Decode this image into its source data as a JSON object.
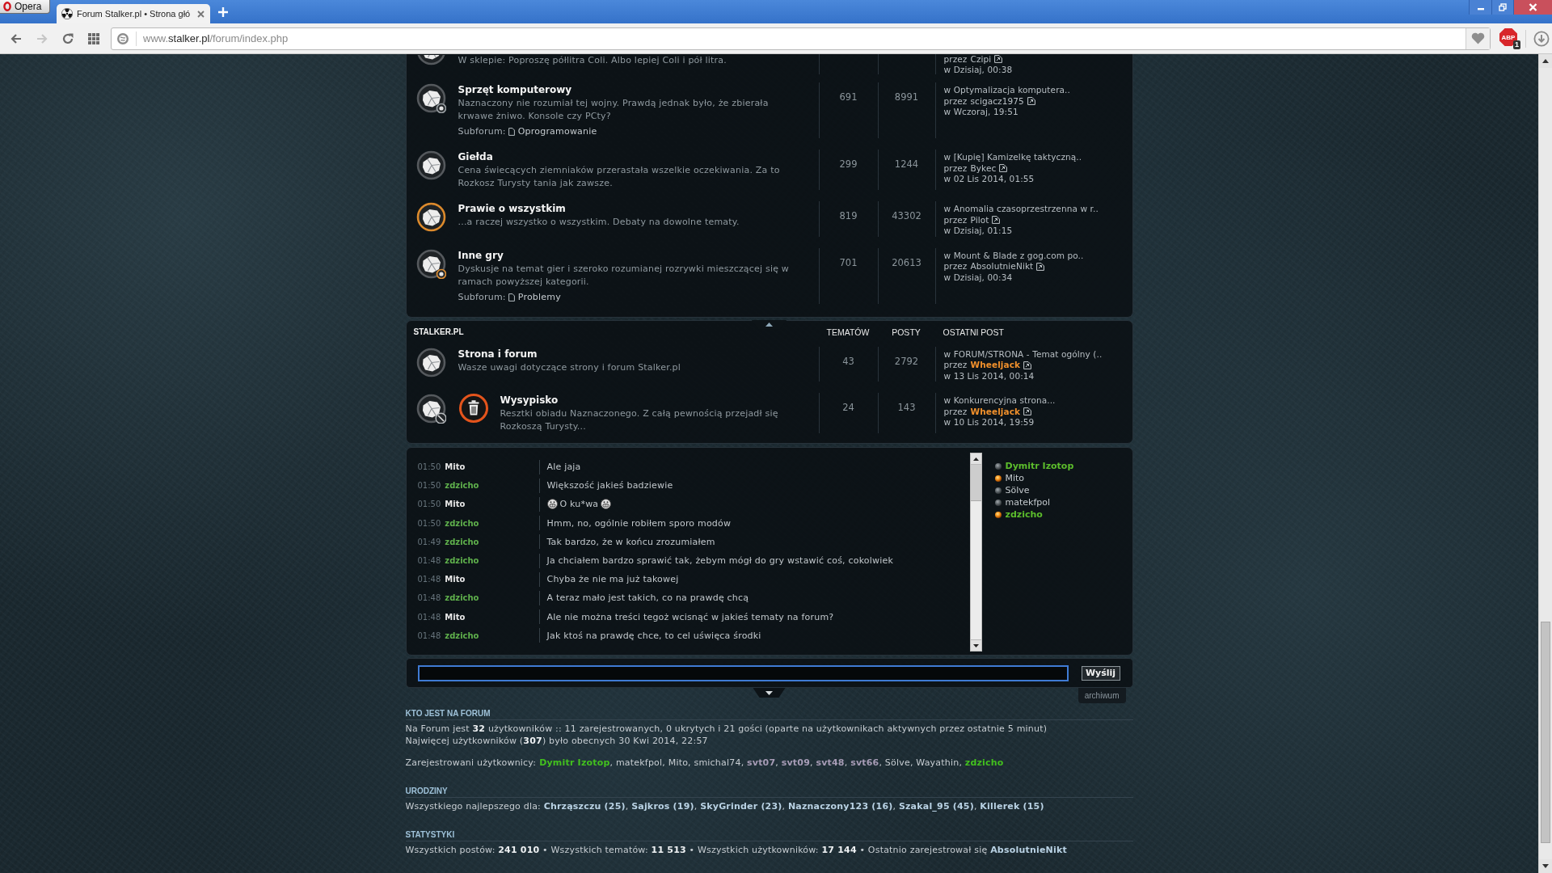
{
  "browser": {
    "menu_button": "Opera",
    "tabs": [
      {
        "title": "Forum Stalker.pl • Strona głó",
        "selected": true
      }
    ],
    "nav_buttons": [
      {
        "kind": "back",
        "disabled": false
      },
      {
        "kind": "forward",
        "disabled": true
      },
      {
        "kind": "reload",
        "disabled": false
      },
      {
        "kind": "speed-dial",
        "disabled": false
      }
    ],
    "address": {
      "prefix": "www.",
      "domain": "stalker.pl",
      "path": "/forum/index.php"
    },
    "extension": {
      "label": "ABP",
      "badge": "1"
    }
  },
  "categories": [
    {
      "forums": [
        {
          "kind": "clipped",
          "unread": false,
          "locked": false,
          "description": "W sklepie: Poproszę półlitra Coli. Albo lepiej Coli i pół litra.",
          "last_post": {
            "by": "przez",
            "author": "Czipi",
            "kind": "plain",
            "color": "#b9c0c5",
            "date": "w Dzisiaj, 00:38"
          }
        },
        {
          "kind": "full",
          "unread": false,
          "locked": false,
          "title": "Sprzęt komputerowy",
          "description": "Naznaczony nie rozumiał tej wojny. Prawdą jednak było, że zbierała krwawe żniwo. Konsole czy PCty?",
          "subforum": {
            "label": "Subforum:",
            "link": "Oprogramowanie",
            "unread": false
          },
          "topics": "691",
          "posts": "8991",
          "last_post": {
            "topic": "w Optymalizacja komputera..",
            "by": "przez",
            "author": "scigacz1975",
            "kind": "plain",
            "color": "#b9c0c5",
            "date": "w Wczoraj, 19:51"
          }
        },
        {
          "kind": "full",
          "unread": false,
          "locked": false,
          "title": "Giełda",
          "description": "Cena świecących ziemniaków przerastała wszelkie oczekiwania. Za to Rozkosz Turysty tania jak zawsze.",
          "topics": "299",
          "posts": "1244",
          "last_post": {
            "topic": "w [Kupię] Kamizelkę taktyczną..",
            "by": "przez",
            "author": "Bykec",
            "kind": "plain",
            "color": "#b9c0c5",
            "date": "w 02 Lis 2014, 01:55"
          }
        },
        {
          "kind": "full",
          "unread": true,
          "locked": false,
          "title": "Prawie o wszystkim",
          "description": "...a raczej wszystko o wszystkim. Debaty na dowolne tematy.",
          "topics": "819",
          "posts": "43302",
          "last_post": {
            "topic": "w Anomalia czasoprzestrzenna w r..",
            "by": "przez",
            "author": "Pilot",
            "kind": "plain",
            "color": "#b9c0c5",
            "date": "w Dzisiaj, 01:15"
          }
        },
        {
          "kind": "full",
          "unread": false,
          "locked": false,
          "title": "Inne gry",
          "description": "Dyskusje na temat gier i szeroko rozumianej rozrywki mieszczącej się w ramach powyższej kategorii.",
          "subforum": {
            "label": "Subforum:",
            "link": "Problemy",
            "unread": true
          },
          "topics": "701",
          "posts": "20613",
          "last_post": {
            "topic": "w Mount & Blade z gog.com po..",
            "by": "przez",
            "author": "AbsolutnieNikt",
            "kind": "plain",
            "color": "#b9c0c5",
            "date": "w Dzisiaj, 00:34"
          }
        }
      ]
    },
    {
      "header": {
        "title": "STALKER.PL",
        "columns": [
          "TEMATÓW",
          "POSTY",
          "OSTATNI POST"
        ]
      },
      "forums": [
        {
          "kind": "full",
          "unread": false,
          "locked": false,
          "title": "Strona i forum",
          "description": "Wasze uwagi dotyczące strony i forum Stalker.pl",
          "topics": "43",
          "posts": "2792",
          "last_post": {
            "topic": "w FORUM/STRONA - Temat ogólny (..",
            "by": "przez",
            "author": "Wheeljack",
            "kind": "colored",
            "color": "#f0902c",
            "date": "w 13 Lis 2014, 00:14"
          }
        },
        {
          "kind": "trash",
          "unread": false,
          "locked": true,
          "title": "Wysypisko",
          "description": "Resztki obiadu Naznaczonego. Z całą pewnością przejadł się Rozkoszą Turysty...",
          "topics": "24",
          "posts": "143",
          "last_post": {
            "topic": "w Konkurencyjna strona...",
            "by": "przez",
            "author": "Wheeljack",
            "kind": "colored",
            "color": "#f0902c",
            "date": "w 10 Lis 2014, 19:59"
          }
        }
      ]
    }
  ],
  "chat": {
    "messages": [
      {
        "time": "01:50",
        "user": "Mito",
        "color": "#e8e8e8",
        "kind": "text",
        "text": "Ale jaja"
      },
      {
        "time": "01:50",
        "user": "zdzicho",
        "color": "#5fb04c",
        "kind": "text",
        "text": "Większość jakieś badziewie"
      },
      {
        "time": "01:50",
        "user": "Mito",
        "color": "#e8e8e8",
        "kind": "smileys",
        "text": "O ku*wa"
      },
      {
        "time": "01:50",
        "user": "zdzicho",
        "color": "#5fb04c",
        "kind": "text",
        "text": "Hmm, no, ogólnie robiłem sporo modów"
      },
      {
        "time": "01:49",
        "user": "zdzicho",
        "color": "#5fb04c",
        "kind": "text",
        "text": "Tak bardzo, że w końcu zrozumiałem"
      },
      {
        "time": "01:48",
        "user": "zdzicho",
        "color": "#5fb04c",
        "kind": "text",
        "text": "Ja chciałem bardzo sprawić tak, żebym mógł do gry wstawić coś, cokolwiek"
      },
      {
        "time": "01:48",
        "user": "Mito",
        "color": "#e8e8e8",
        "kind": "text",
        "text": "Chyba że nie ma już takowej"
      },
      {
        "time": "01:48",
        "user": "zdzicho",
        "color": "#5fb04c",
        "kind": "text",
        "text": "A teraz mało jest takich, co na prawdę chcą"
      },
      {
        "time": "01:48",
        "user": "Mito",
        "color": "#e8e8e8",
        "kind": "text",
        "text": "Ale nie można treści tegoż wcisnąć w jakieś tematy na forum?"
      },
      {
        "time": "01:48",
        "user": "zdzicho",
        "color": "#5fb04c",
        "kind": "text",
        "text": "Jak ktoś na prawdę chce, to cel uświęca środki"
      }
    ],
    "online": [
      {
        "name": "Dymitr Izotop",
        "kind": "colored",
        "color": "#5cbd2c",
        "active": false
      },
      {
        "name": "Mito",
        "kind": "plain",
        "color": "#c3c9cd",
        "active": true
      },
      {
        "name": "Sölve",
        "kind": "plain",
        "color": "#c3c9cd",
        "active": false
      },
      {
        "name": "matekfpol",
        "kind": "plain",
        "color": "#c3c9cd",
        "active": false
      },
      {
        "name": "zdzicho",
        "kind": "colored",
        "color": "#5cbd2c",
        "active": true
      }
    ],
    "input": {
      "focused": true
    },
    "send_button": "Wyślij",
    "archive_link": "archiwum"
  },
  "who_is_online": {
    "heading": "KTO JEST NA FORUM",
    "lines": [
      "Na Forum jest **32** użytkowników :: 11 zarejestrowanych, 0 ukrytych i 21 gości (oparte na użytkownikach aktywnych przez ostatnie 5 minut)",
      "Najwięcej użytkowników (**307**) było obecnych 30 Kwi 2014, 22:57"
    ],
    "registered": {
      "label": "Zarejestrowani użytkownicy:",
      "separator": ", ",
      "users": [
        {
          "name": "Dymitr Izotop",
          "kind": "colored",
          "color": "#42c01e"
        },
        {
          "name": "matekfpol",
          "kind": "plain",
          "color": "#c7cdd2"
        },
        {
          "name": "Mito",
          "kind": "plain",
          "color": "#c7cdd2"
        },
        {
          "name": "smichal74",
          "kind": "plain",
          "color": "#c7cdd2"
        },
        {
          "name": "svt07",
          "kind": "colored",
          "color": "#a79cb6"
        },
        {
          "name": "svt09",
          "kind": "colored",
          "color": "#a79cb6"
        },
        {
          "name": "svt48",
          "kind": "colored",
          "color": "#a79cb6"
        },
        {
          "name": "svt66",
          "kind": "colored",
          "color": "#a79cb6"
        },
        {
          "name": "Sölve",
          "kind": "plain",
          "color": "#c7cdd2"
        },
        {
          "name": "Wayathin",
          "kind": "plain",
          "color": "#c7cdd2"
        },
        {
          "name": "zdzicho",
          "kind": "colored",
          "color": "#42c01e"
        }
      ]
    }
  },
  "birthdays": {
    "heading": "URODZINY",
    "text": "Wszystkiego najlepszego dla: **Chrząszczu (25)**, **Sajkros (19)**, **SkyGrinder (23)**, **Naznaczony123 (16)**, **Szakal_95 (45)**, **Killerek (15)**"
  },
  "statistics": {
    "heading": "STATYSTYKI",
    "text": "Wszystkich postów: **241 010** • Wszystkich tematów: **11 513** • Wszystkich użytkowników: **17 144** • Ostatnio zarejestrował się **AbsolutnieNikt**"
  }
}
